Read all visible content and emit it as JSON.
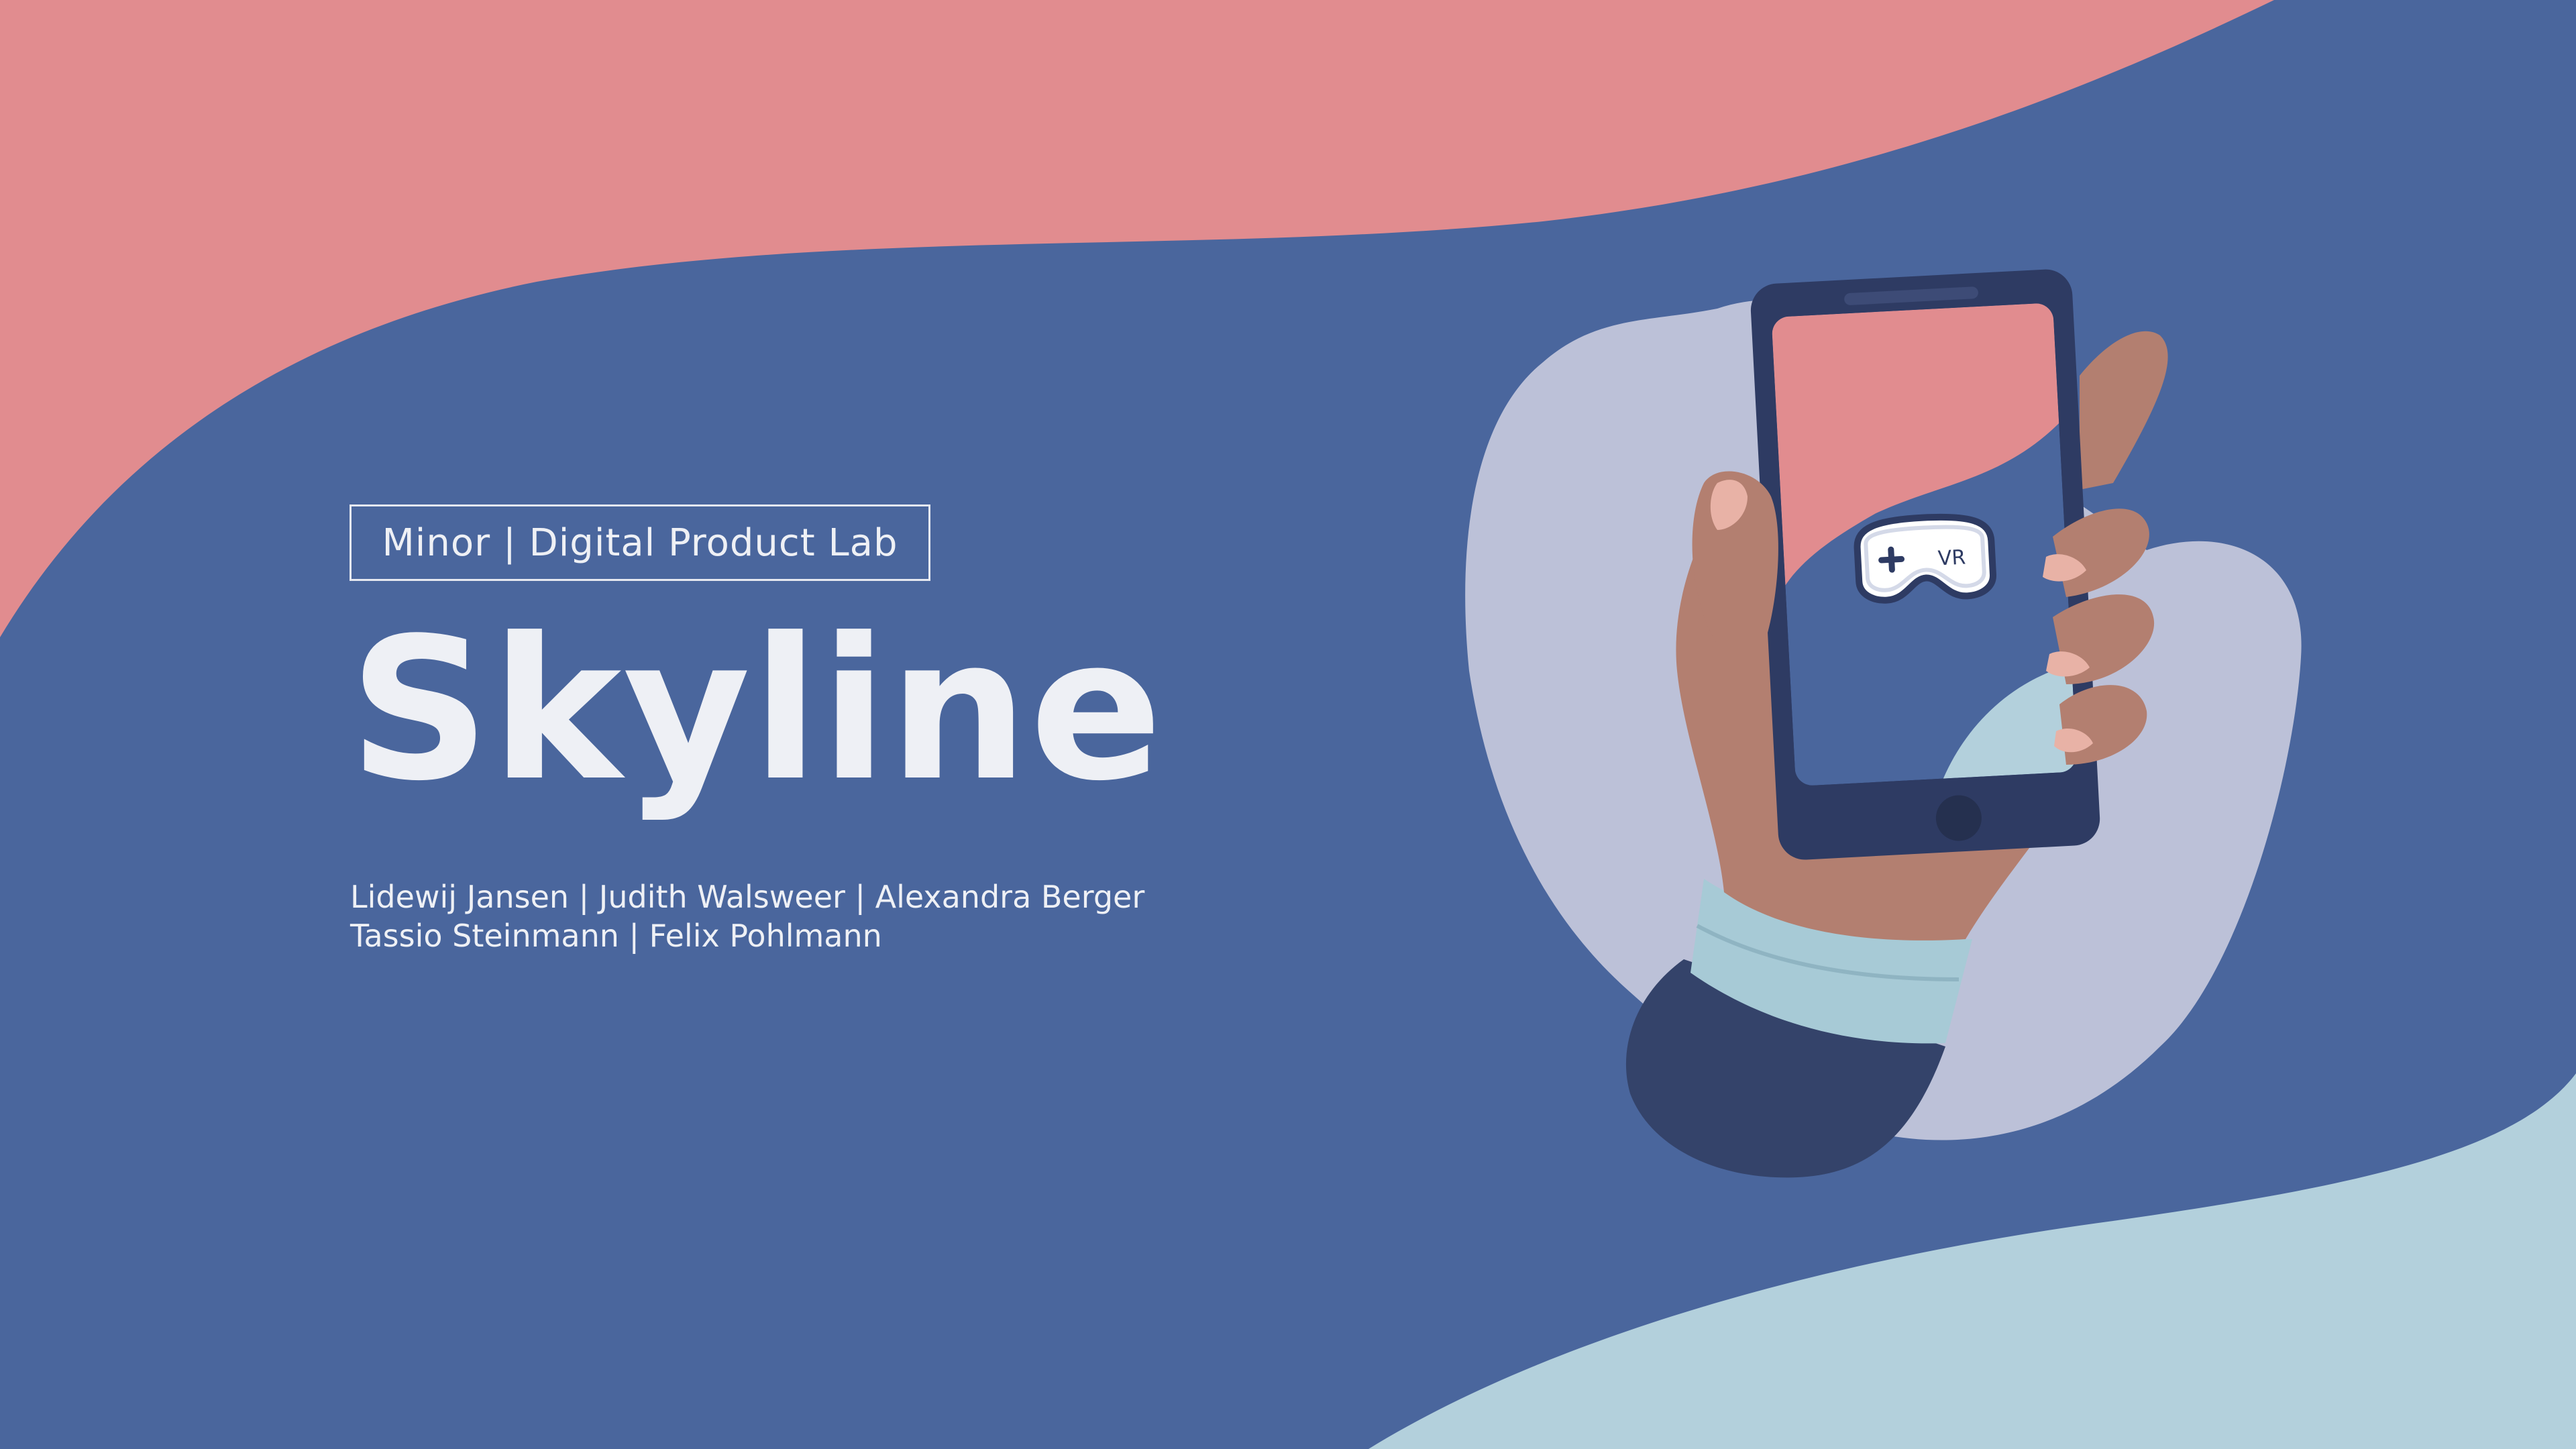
{
  "slide": {
    "label": "Minor | Digital Product Lab",
    "title": "Skyline",
    "authors_line1": "Lidewij Jansen | Judith Walsweer | Alexandra Berger",
    "authors_line2": "Tassio Steinmann | Felix Pohlmann",
    "vr_text": "VR"
  },
  "colors": {
    "background_blue": "#4a669d",
    "pink": "#e18c8f",
    "light_blue": "#b3d0dc",
    "lavender": "#bcc1d8",
    "text": "#eef0f5"
  },
  "icons": {
    "illustration": "hand-holding-phone",
    "headset": "vr-headset-icon"
  }
}
